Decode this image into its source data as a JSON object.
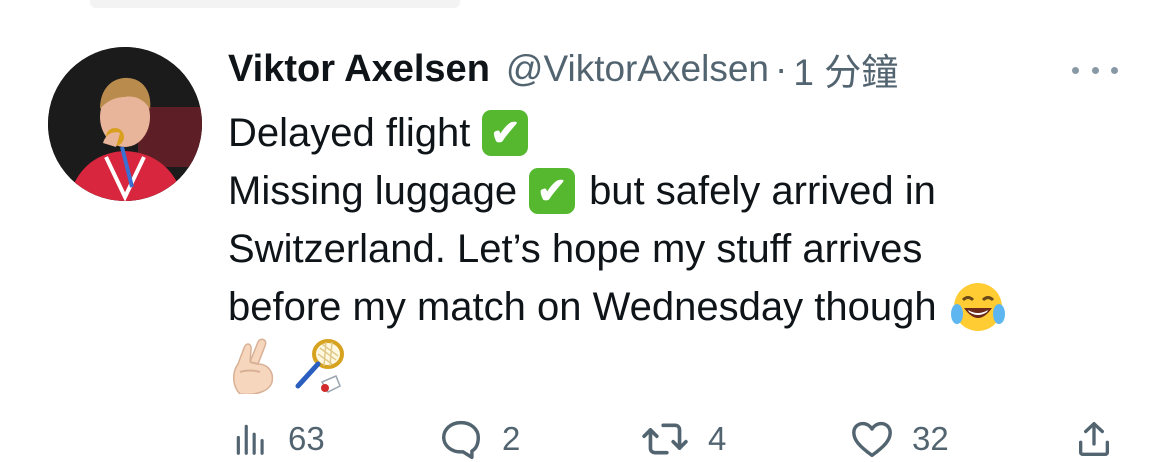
{
  "tweet": {
    "author_name": "Viktor Axelsen",
    "handle": "@ViktorAxelsen",
    "separator": "·",
    "time": "1 分鐘",
    "lines": [
      "Delayed flight",
      "Missing luggage",
      "but safely arrived in",
      "Switzerland. Let’s hope my stuff arrives",
      "before my match on Wednesday though"
    ],
    "check_mark": "✔",
    "emojis": [
      "white-check-mark",
      "face-with-tears-of-joy",
      "crossed-fingers",
      "badminton"
    ]
  },
  "actions": {
    "views": "63",
    "replies": "2",
    "retweets": "4",
    "likes": "32"
  },
  "colors": {
    "text": "#0f1419",
    "muted": "#536471",
    "check_green": "#55b82e"
  }
}
